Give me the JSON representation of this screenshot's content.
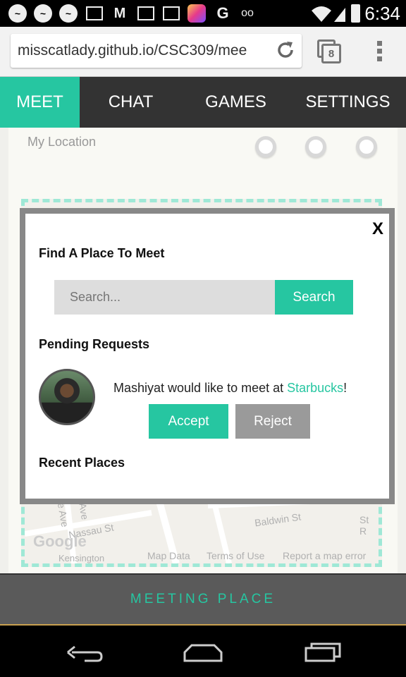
{
  "status_bar": {
    "time": "6:34",
    "icons": [
      "messenger-icon",
      "messenger-icon",
      "messenger-icon",
      "image-icon",
      "gmail-icon",
      "camera-icon",
      "mail-icon",
      "instagram-icon",
      "google-icon",
      "voicemail-icon",
      "wifi-icon",
      "signal-icon",
      "battery-icon"
    ]
  },
  "browser": {
    "url": "misscatlady.github.io/CSC309/mee",
    "tab_count": "8"
  },
  "nav": {
    "tabs": [
      {
        "label": "MEET",
        "active": true
      },
      {
        "label": "CHAT",
        "active": false
      },
      {
        "label": "GAMES",
        "active": false
      },
      {
        "label": "SETTINGS",
        "active": false
      }
    ]
  },
  "content": {
    "my_location_label": "My Location",
    "map_labels": {
      "nassau": "Nassau St",
      "baldwin": "Baldwin St",
      "kensington": "Kensington",
      "bellevue": "evue Ave",
      "ave": "Ave",
      "st_r": "St R",
      "map_data": "Map Data",
      "terms": "Terms of Use",
      "report": "Report a map error",
      "google": "Google"
    }
  },
  "modal": {
    "close_label": "X",
    "find_heading": "Find A Place To Meet",
    "search_placeholder": "Search...",
    "search_button": "Search",
    "pending_heading": "Pending Requests",
    "request": {
      "name": "Mashiyat",
      "text_middle": " would like to meet at ",
      "place": "Starbucks",
      "text_end": "!"
    },
    "accept_label": "Accept",
    "reject_label": "Reject",
    "recent_heading": "Recent Places"
  },
  "bottom_bar": {
    "label": "MEETING PLACE"
  },
  "colors": {
    "accent": "#26c6a1",
    "nav_bg": "#333333",
    "reject_bg": "#9a9a9a"
  }
}
